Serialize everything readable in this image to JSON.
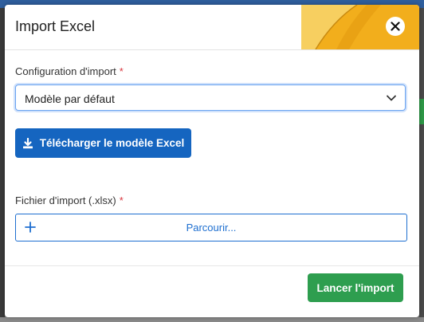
{
  "modal": {
    "title": "Import Excel",
    "close_icon": "close-icon"
  },
  "config": {
    "label": "Configuration d'import",
    "required_mark": "*",
    "selected_value": "Modèle par défaut",
    "chevron_icon": "chevron-down-icon"
  },
  "download_button": {
    "icon": "download-icon",
    "label": "Télécharger le modèle Excel"
  },
  "file": {
    "label": "Fichier d'import (.xlsx)",
    "required_mark": "*",
    "plus_icon": "plus-icon",
    "browse_label": "Parcourir..."
  },
  "footer": {
    "submit_label": "Lancer l'import"
  },
  "colors": {
    "primary": "#1565c0",
    "success": "#2e9e4f",
    "required": "#d9363e",
    "header_accent": "#f2ae1c"
  }
}
